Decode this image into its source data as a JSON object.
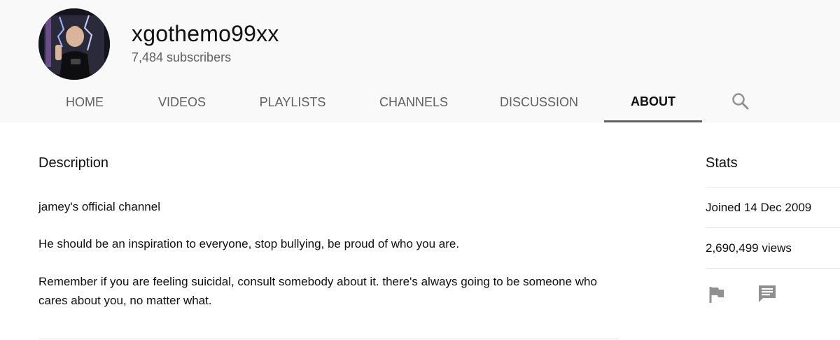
{
  "channel": {
    "name": "xgothemo99xx",
    "subscribers": "7,484 subscribers"
  },
  "tabs": [
    {
      "label": "HOME"
    },
    {
      "label": "VIDEOS"
    },
    {
      "label": "PLAYLISTS"
    },
    {
      "label": "CHANNELS"
    },
    {
      "label": "DISCUSSION"
    },
    {
      "label": "ABOUT",
      "active": true
    }
  ],
  "icons": {
    "search": "search-icon",
    "flag": "flag-icon",
    "message": "message-icon"
  },
  "about": {
    "description_title": "Description",
    "paragraphs": [
      "jamey's official channel",
      "He should be an inspiration to everyone, stop bullying, be proud of who you are.",
      "Remember if you are feeling suicidal, consult somebody about it. there's always going to be someone who cares about you, no matter what."
    ]
  },
  "stats": {
    "title": "Stats",
    "joined": "Joined 14 Dec 2009",
    "views": "2,690,499 views"
  },
  "colors": {
    "header_bg": "#f9f9f9",
    "tab_inactive": "#606060",
    "tab_active": "#0f0f0f",
    "icon_gray": "#909090"
  }
}
